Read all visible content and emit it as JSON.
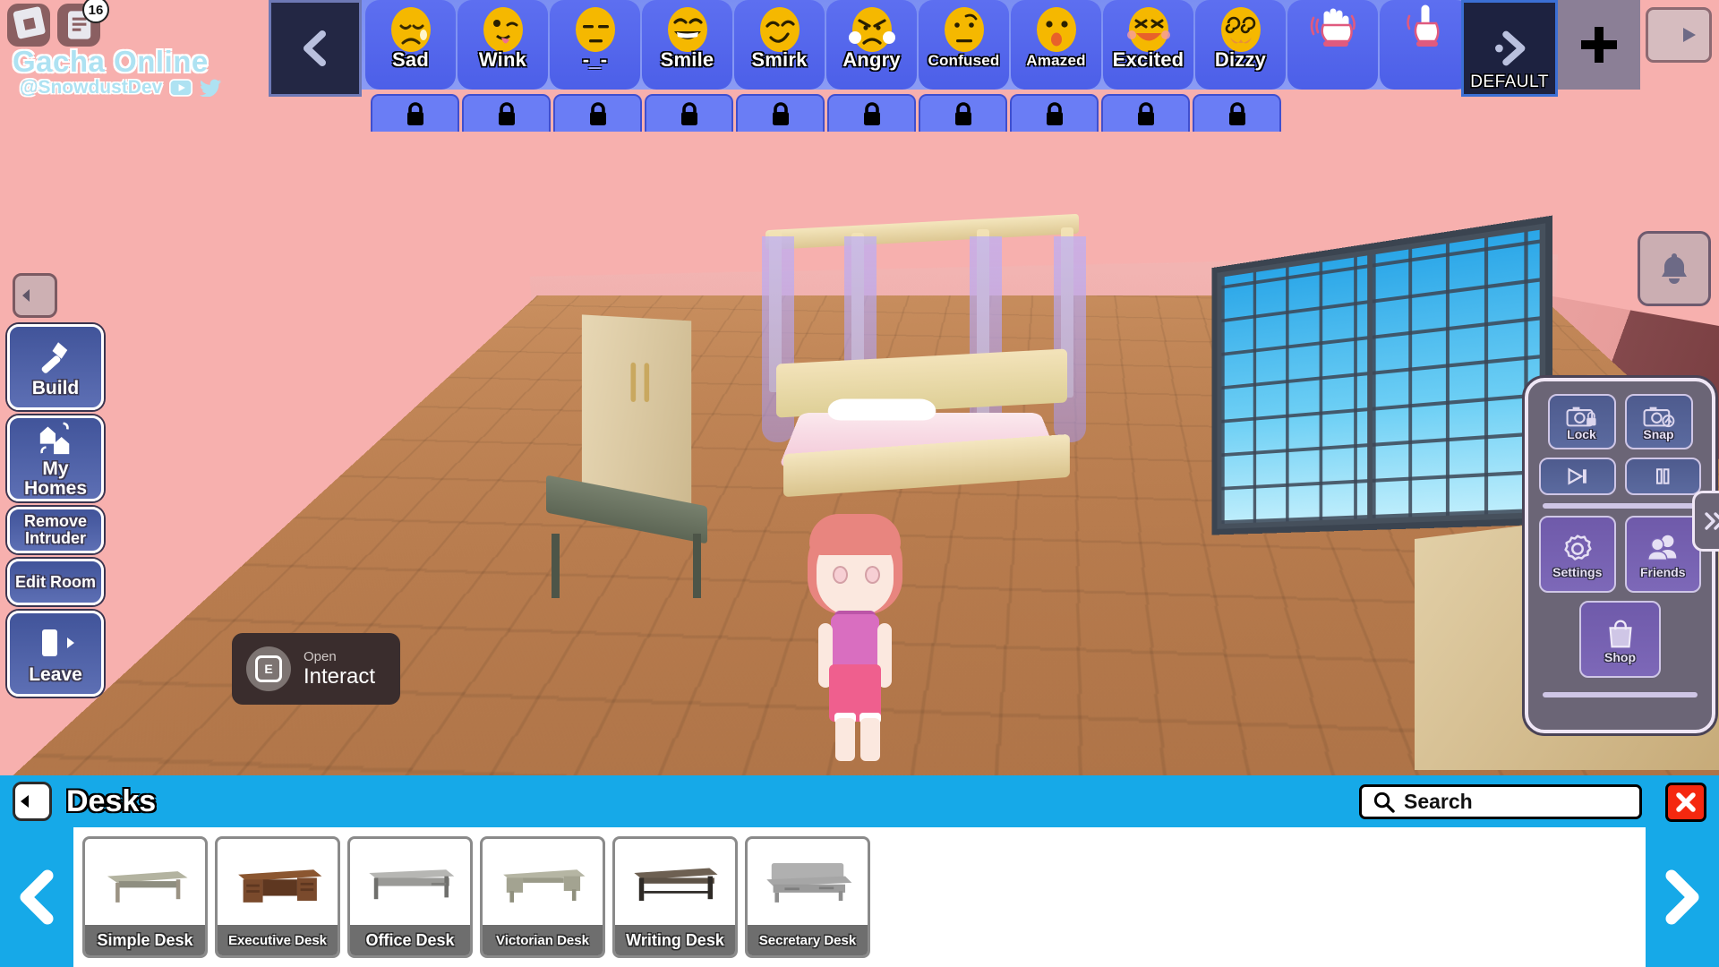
{
  "brand": {
    "title": "Gacha Online",
    "handle": "@SnowdustDev",
    "notification_count": "16",
    "roblox_icon": "roblox-logo-icon",
    "notes_icon": "notes-icon",
    "youtube_icon": "youtube-icon",
    "twitter_icon": "twitter-icon"
  },
  "emote_bar": {
    "back_icon": "chevron-left-icon",
    "default_label": "DEFAULT",
    "default_icon": "chevron-right-icon",
    "plus_icon": "plus-icon",
    "nav_next_icon": "arrow-right-icon",
    "locked_count": 10,
    "emotes": [
      {
        "label": "Sad",
        "face": "sad"
      },
      {
        "label": "Wink",
        "face": "wink"
      },
      {
        "label": "-_-",
        "face": "neutral"
      },
      {
        "label": "Smile",
        "face": "smile"
      },
      {
        "label": "Smirk",
        "face": "smirk"
      },
      {
        "label": "Angry",
        "face": "angry"
      },
      {
        "label": "Confused",
        "face": "confused"
      },
      {
        "label": "Amazed",
        "face": "amazed"
      },
      {
        "label": "Excited",
        "face": "excited"
      },
      {
        "label": "Dizzy",
        "face": "dizzy"
      },
      {
        "label": "",
        "face": "wave-hand"
      },
      {
        "label": "",
        "face": "point-hand"
      }
    ]
  },
  "sidebar": {
    "back_icon": "arrow-left-icon",
    "items": [
      {
        "label": "Build",
        "icon": "hammer-icon",
        "size": "tall"
      },
      {
        "label": "My Homes",
        "icon": "houses-icon",
        "size": "tall"
      },
      {
        "label": "Remove Intruder",
        "icon": "",
        "size": "short"
      },
      {
        "label": "Edit Room",
        "icon": "",
        "size": "short"
      },
      {
        "label": "Leave",
        "icon": "exit-icon",
        "size": "tall"
      }
    ]
  },
  "interact_prompt": {
    "key": "E",
    "action_top": "Open",
    "action_main": "Interact"
  },
  "right_panel": {
    "bell_icon": "bell-icon",
    "expand_icon": "double-chevron-right-icon",
    "buttons": [
      {
        "label": "Lock",
        "icon": "camera-lock-icon"
      },
      {
        "label": "Snap",
        "icon": "camera-snap-icon"
      },
      {
        "label": "",
        "icon": "play-to-end-icon"
      },
      {
        "label": "",
        "icon": "pause-icon"
      },
      {
        "label": "Settings",
        "icon": "gear-icon"
      },
      {
        "label": "Friends",
        "icon": "friends-icon"
      },
      {
        "label": "Shop",
        "icon": "shopping-bag-icon"
      }
    ]
  },
  "catalog": {
    "back_icon": "arrow-left-icon",
    "title": "Desks",
    "search_placeholder": "Search",
    "search_icon": "search-icon",
    "close_icon": "close-icon",
    "prev_icon": "chevron-left-icon",
    "next_icon": "chevron-right-icon",
    "items": [
      {
        "name": "Simple Desk",
        "color": "#9a9a82"
      },
      {
        "name": "Executive Desk",
        "color": "#7a4a2c"
      },
      {
        "name": "Office Desk",
        "color": "#9a9a99"
      },
      {
        "name": "Victorian Desk",
        "color": "#a6a694"
      },
      {
        "name": "Writing Desk",
        "color": "#5e5347"
      },
      {
        "name": "Secretary Desk",
        "color": "#a0a0a0"
      }
    ]
  },
  "colors": {
    "accent_blue": "#16a9e8",
    "emote_bar": "#7b8ff2",
    "panel_purple": "#6f5aaa",
    "close_red": "#f5280f",
    "background_pink": "#f7b0ae"
  }
}
